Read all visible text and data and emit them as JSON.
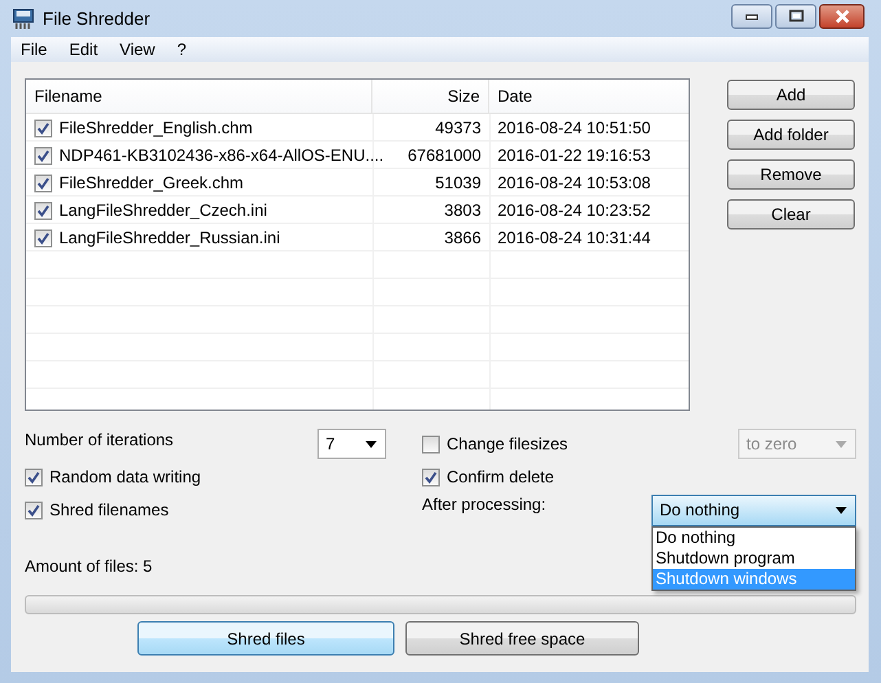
{
  "window": {
    "title": "File Shredder"
  },
  "menu": [
    "File",
    "Edit",
    "View",
    "?"
  ],
  "file_list": {
    "columns": [
      "Filename",
      "Size",
      "Date"
    ],
    "rows": [
      {
        "checked": true,
        "filename": "FileShredder_English.chm",
        "size": "49373",
        "date": "2016-08-24 10:51:50"
      },
      {
        "checked": true,
        "filename": "NDP461-KB3102436-x86-x64-AllOS-ENU....",
        "size": "67681000",
        "date": "2016-01-22 19:16:53"
      },
      {
        "checked": true,
        "filename": "FileShredder_Greek.chm",
        "size": "51039",
        "date": "2016-08-24 10:53:08"
      },
      {
        "checked": true,
        "filename": "LangFileShredder_Czech.ini",
        "size": "3803",
        "date": "2016-08-24 10:23:52"
      },
      {
        "checked": true,
        "filename": "LangFileShredder_Russian.ini",
        "size": "3866",
        "date": "2016-08-24 10:31:44"
      }
    ]
  },
  "side_buttons": [
    "Add",
    "Add folder",
    "Remove",
    "Clear"
  ],
  "options": {
    "iterations": {
      "label": "Number of iterations",
      "value": "7"
    },
    "change_filesizes": {
      "label": "Change filesizes",
      "checked": false
    },
    "filesize_mode": {
      "value": "to zero",
      "disabled": true
    },
    "random_data_writing": {
      "label": "Random data writing",
      "checked": true
    },
    "confirm_delete": {
      "label": "Confirm delete",
      "checked": true
    },
    "shred_filenames": {
      "label": "Shred filenames",
      "checked": true
    },
    "after_processing": {
      "label": "After processing:",
      "value": "Do nothing",
      "expanded": true,
      "options": [
        {
          "label": "Do nothing",
          "highlighted": false
        },
        {
          "label": "Shutdown program",
          "highlighted": false
        },
        {
          "label": "Shutdown windows",
          "highlighted": true
        }
      ]
    }
  },
  "amount_of_files": "Amount of files: 5",
  "buttons": [
    {
      "label": "Shred files",
      "default": true
    },
    {
      "label": "Shred free space",
      "default": false
    }
  ]
}
